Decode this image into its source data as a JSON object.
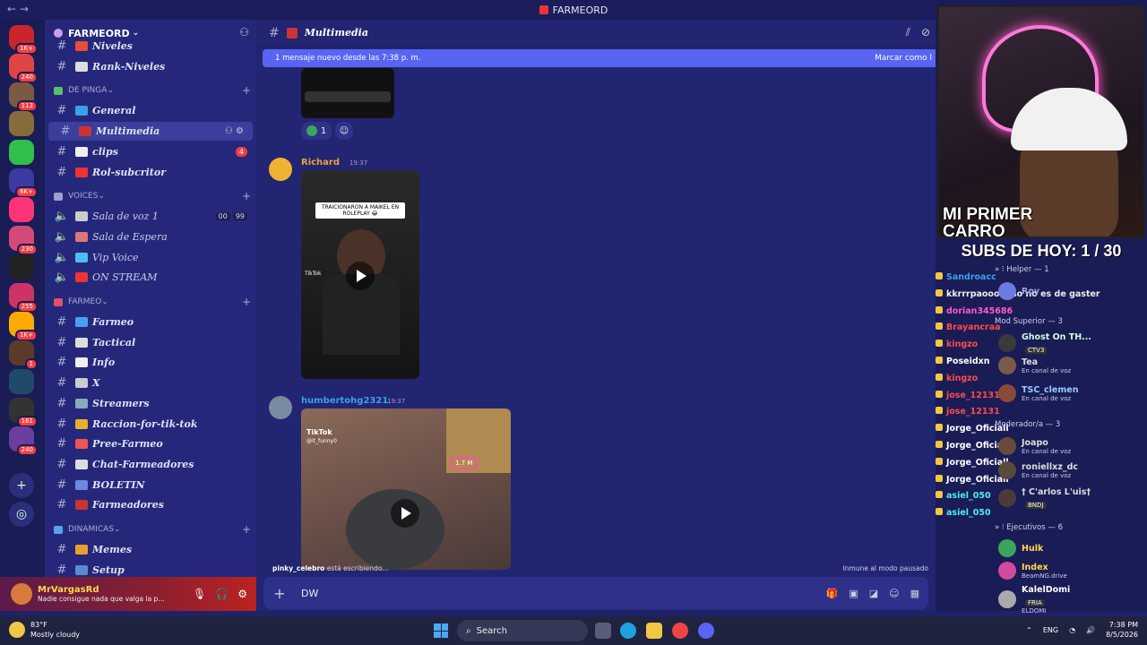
{
  "window": {
    "title": "FARMEORD"
  },
  "servers": [
    {
      "badge": "1K+",
      "color": "#c8262b"
    },
    {
      "badge": "240",
      "color": "#e04545"
    },
    {
      "badge": "113",
      "color": "#7a5a40"
    },
    {
      "badge": "",
      "color": "#886b3a"
    },
    {
      "badge": "",
      "color": "#2fbf4a"
    },
    {
      "badge": "6K+",
      "color": "#3a3aa0"
    },
    {
      "badge": "",
      "color": "#ff3377"
    },
    {
      "badge": "230",
      "color": "#d34a7a"
    },
    {
      "badge": "",
      "color": "#222"
    },
    {
      "badge": "255",
      "color": "#cc3366"
    },
    {
      "badge": "1K+",
      "color": "#ffaa00"
    },
    {
      "badge": "1",
      "color": "#5a3b2a"
    },
    {
      "badge": "",
      "color": "#214a6a"
    },
    {
      "badge": "161",
      "color": "#333"
    },
    {
      "badge": "240",
      "color": "#6a3fa0"
    }
  ],
  "server": {
    "name": "FARMEORD"
  },
  "sidebar": {
    "top_channels": [
      {
        "name": "Niveles",
        "color": "#e74c3c"
      },
      {
        "name": "Rank-Niveles",
        "color": "#ddd"
      }
    ],
    "categories": [
      {
        "name": "DE PINGA",
        "channels": [
          {
            "name": "General",
            "icon_color": "#3aa0e8",
            "type": "text"
          },
          {
            "name": "Multimedia",
            "icon_color": "#cc3333",
            "type": "text",
            "active": true
          },
          {
            "name": "clips",
            "icon_color": "#eee",
            "type": "text",
            "count": "4"
          },
          {
            "name": "Rol-subcritor",
            "icon_color": "#e33",
            "type": "text"
          }
        ]
      },
      {
        "name": "VOICES",
        "channels": [
          {
            "name": "Sala de voz 1",
            "icon_color": "#ccc",
            "type": "voice",
            "v1": "00",
            "v2": "99"
          },
          {
            "name": "Sala de Espera",
            "icon_color": "#d77",
            "type": "voice"
          },
          {
            "name": "Vip Voice",
            "icon_color": "#4ac0f0",
            "type": "voice"
          },
          {
            "name": "ON STREAM",
            "icon_color": "#e33",
            "type": "voice"
          }
        ]
      },
      {
        "name": "FARMEO",
        "channels": [
          {
            "name": "Farmeo",
            "icon_color": "#4aa0f0",
            "type": "text"
          },
          {
            "name": "Tactical",
            "icon_color": "#ddd",
            "type": "text"
          },
          {
            "name": "Info",
            "icon_color": "#eee",
            "type": "text"
          },
          {
            "name": "X",
            "icon_color": "#ccc",
            "type": "text"
          },
          {
            "name": "Streamers",
            "icon_color": "#8ab",
            "type": "text"
          },
          {
            "name": "Raccion-for-tik-tok",
            "icon_color": "#e8b030",
            "type": "text"
          },
          {
            "name": "Pree-Farmeo",
            "icon_color": "#e55",
            "type": "text"
          },
          {
            "name": "Chat-Farmeadores",
            "icon_color": "#ddd",
            "type": "text"
          },
          {
            "name": "BOLETIN",
            "icon_color": "#6a8ae0",
            "type": "text"
          },
          {
            "name": "Farmeadores",
            "icon_color": "#c33",
            "type": "text"
          }
        ]
      },
      {
        "name": "DINAMICAS",
        "channels": [
          {
            "name": "Memes",
            "icon_color": "#e8a030",
            "type": "text"
          },
          {
            "name": "Setup",
            "icon_color": "#5a8ad0",
            "type": "text"
          }
        ]
      }
    ]
  },
  "user": {
    "name": "MrVargasRd",
    "status": "Nadie consigue nada que valga la p..."
  },
  "chat": {
    "channel": "Multimedia",
    "new_banner": "1 mensaje nuevo desde las 7:38 p. m.",
    "mark_read": "Marcar como l",
    "messages": [
      {
        "author": "Richard",
        "time": "19:37",
        "author_color": "#e8a238",
        "video_caption": "TRAICIONARON A MAIKEL EN ROLEPLAY 😂",
        "tiktok": "TikTok"
      },
      {
        "author": "humbertohg2321",
        "time": "19:37",
        "author_color": "#3aa0e8",
        "tiktok": "TikTok",
        "tiktok_user": "@it_funny0",
        "views": "1.7 M"
      }
    ],
    "reaction_count": "1",
    "typing_user": "pinky_celebro",
    "typing_suffix": " está escribiendo...",
    "immune_text": "Inmune al modo pausado",
    "composer_text": "DW"
  },
  "overlay": {
    "caption_line1": "MI PRIMER",
    "caption_line2": "CARRO",
    "subs_text": "SUBS DE HOY: 1 / 30",
    "chat_lines": [
      {
        "user": "Sandroacc",
        "color": "#3aa0e8"
      },
      {
        "user": "kkrrrpaooo :eso no es de gaster",
        "color": "#eee"
      },
      {
        "user": "dorian345686",
        "color": "#ff5ac8"
      },
      {
        "user": "Brayancraa",
        "color": "#ff4a4a"
      },
      {
        "user": "kingzo",
        "color": "#ff4a4a"
      },
      {
        "user": "Poseidxn",
        "color": "#fff"
      },
      {
        "user": "kingzo",
        "color": "#ff4a4a"
      },
      {
        "user": "jose_12131",
        "color": "#ff4a4a"
      },
      {
        "user": "jose_12131",
        "color": "#ff4a4a"
      },
      {
        "user": "Jorge_Oficiall",
        "color": "#fff"
      },
      {
        "user": "Jorge_Oficiall",
        "color": "#fff"
      },
      {
        "user": "Jorge_Oficiall",
        "color": "#fff"
      },
      {
        "user": "Jorge_Oficiall",
        "color": "#fff"
      },
      {
        "user": "asiel_050",
        "color": "#4af0f0"
      },
      {
        "user": "asiel_050",
        "color": "#4af0f0"
      }
    ],
    "helper_label": "» ⁝ Helper — 1",
    "mod_label": "Mod Superior — 3",
    "moderador_label": "Moderador/a — 3",
    "ejecutivos_label": "» ⁝ Ejecutivos — 6",
    "members": [
      {
        "name": "Roy",
        "sub": "",
        "color": "#9ad"
      },
      {
        "name": "Ghost On TH...",
        "sub": "",
        "tag": "CTV3",
        "color": "#cfd"
      },
      {
        "name": "Tea",
        "sub": "En canal de voz",
        "color": "#ddd"
      },
      {
        "name": "TSC_clemen",
        "sub": "En canal de voz",
        "color": "#9cf"
      },
      {
        "name": "Joapo",
        "sub": "En canal de voz",
        "color": "#ddd"
      },
      {
        "name": "roniellxz_dc",
        "sub": "En canal de voz",
        "color": "#ddd"
      },
      {
        "name": "† C'arlos L'uis†",
        "sub": "",
        "tag": "BNDJ",
        "color": "#ddd"
      },
      {
        "name": "Hulk",
        "sub": "",
        "color": "#ffd84a"
      },
      {
        "name": "Index",
        "sub": "BeamNG.drive",
        "color": "#ffd84a"
      },
      {
        "name": "KalelDomi",
        "sub": "ELDOMI",
        "tag": "FRIA",
        "color": "#fff"
      }
    ]
  },
  "taskbar": {
    "temp": "83°F",
    "weather": "Mostly cloudy",
    "search": "Search",
    "lang": "ENG",
    "time": "7:38 PM",
    "date": "8/5/2026"
  }
}
